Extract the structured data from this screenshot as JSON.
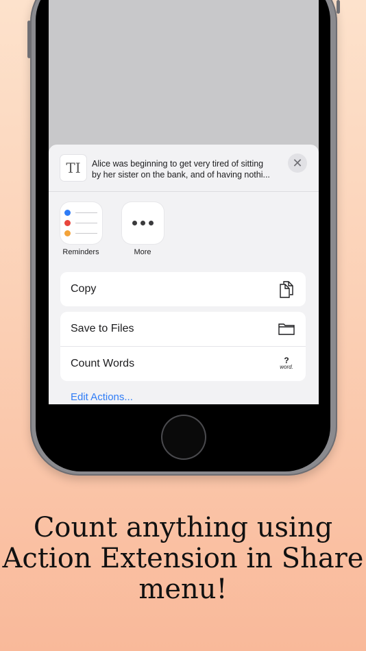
{
  "share_sheet": {
    "preview": {
      "doc_icon_glyph": "TI",
      "line1": "Alice was beginning to get very tired of sitting",
      "line2": "by her sister on the bank, and of having nothi...",
      "close_glyph": "✕"
    },
    "apps": [
      {
        "label": "Reminders",
        "icon": "reminders-icon"
      },
      {
        "label": "More",
        "icon": "more-icon"
      }
    ],
    "actions_group1": [
      {
        "label": "Copy",
        "icon": "copy-icon"
      }
    ],
    "actions_group2": [
      {
        "label": "Save to Files",
        "icon": "folder-icon"
      },
      {
        "label": "Count Words",
        "icon": "word-count-icon",
        "icon_text_top": "?",
        "icon_text_bottom": "word."
      }
    ],
    "edit_actions_label": "Edit Actions..."
  },
  "caption": {
    "line1": "Count anything using",
    "line2": "Action Extension in Share",
    "line3": "menu!"
  },
  "colors": {
    "reminder_dot1": "#2f7cf6",
    "reminder_dot2": "#e8453c",
    "reminder_dot3": "#f3a33a",
    "link": "#2f7cf6"
  }
}
